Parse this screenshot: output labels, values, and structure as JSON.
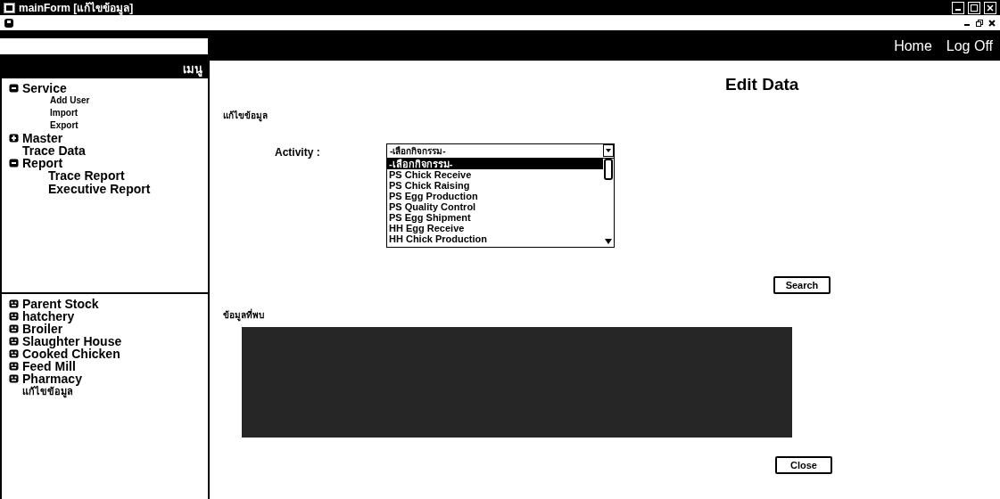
{
  "window": {
    "title": "mainForm [แก้ไขข้อมูล]"
  },
  "top_bar": {
    "links": [
      "Home",
      "Log Off"
    ]
  },
  "sidebar": {
    "header": "เมนู",
    "menu": [
      {
        "label": "Service",
        "kind": "group",
        "expanded": true,
        "children": [
          {
            "label": "Add User",
            "kind": "small"
          },
          {
            "label": "Import",
            "kind": "small"
          },
          {
            "label": "Export",
            "kind": "small"
          }
        ]
      },
      {
        "label": "Master",
        "kind": "group",
        "expanded": false
      },
      {
        "label": "Trace Data",
        "kind": "leaf",
        "expanded": false
      },
      {
        "label": "Report",
        "kind": "group",
        "expanded": true,
        "children": [
          {
            "label": "Trace Report",
            "kind": "large"
          },
          {
            "label": "Executive Report",
            "kind": "large"
          }
        ]
      }
    ],
    "modules": [
      {
        "label": "Parent Stock",
        "kind": "module"
      },
      {
        "label": "hatchery",
        "kind": "module"
      },
      {
        "label": "Broiler",
        "kind": "module"
      },
      {
        "label": "Slaughter House",
        "kind": "module"
      },
      {
        "label": "Cooked Chicken",
        "kind": "module"
      },
      {
        "label": "Feed Mill",
        "kind": "module"
      },
      {
        "label": "Pharmacy",
        "kind": "module"
      },
      {
        "label": "แก้ไขข้อมูล",
        "kind": "link"
      }
    ]
  },
  "content": {
    "heading": "Edit Data",
    "section_label": "แก้ไขข้อมูล",
    "activity": {
      "label": "Activity :",
      "value": "-เลือกกิจกรรม-",
      "options": [
        {
          "label": "-เลือกกิจกรรม-",
          "selected": true
        },
        {
          "label": "PS Chick Receive",
          "selected": false
        },
        {
          "label": "PS Chick Raising",
          "selected": false
        },
        {
          "label": "PS Egg Production",
          "selected": false
        },
        {
          "label": "PS Quality Control",
          "selected": false
        },
        {
          "label": "PS Egg Shipment",
          "selected": false
        },
        {
          "label": "HH Egg Receive",
          "selected": false
        },
        {
          "label": "HH Chick Production",
          "selected": false
        }
      ]
    },
    "search_button": "Search",
    "results_label": "ข้อมูลที่พบ",
    "close_button": "Close"
  }
}
